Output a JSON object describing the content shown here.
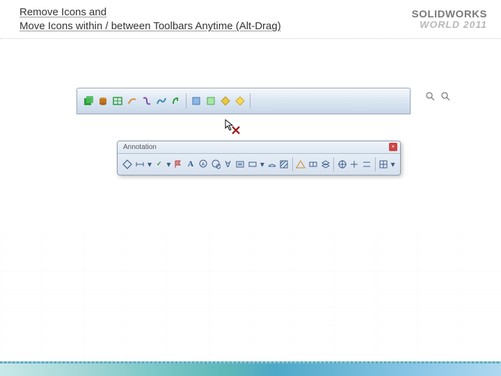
{
  "title_line1": "Remove Icons and",
  "title_line2": "Move Icons within / between Toolbars Anytime (Alt-Drag)",
  "logo": {
    "main": "SOLIDWORKS",
    "sub": "WORLD 2011"
  },
  "floating_toolbar": {
    "title": "Annotation"
  },
  "icons": {
    "main": [
      "box-green",
      "cylinder",
      "table",
      "curve-sweep",
      "curve-s",
      "spline",
      "curve-hook",
      "sep",
      "edit-a",
      "edit-b",
      "diamond",
      "diamond-yellow",
      "sep"
    ],
    "annotation": [
      "diamond-tool",
      "dim",
      "dropdown",
      "abc-check",
      "dropdown",
      "flag",
      "bold-a",
      "balloon-a",
      "balloon-b",
      "symbol-v",
      "note",
      "rect-note",
      "dropdown",
      "surface",
      "hatch",
      "sep",
      "warn",
      "tolerance",
      "layer",
      "sep",
      "target",
      "center-a",
      "center-b",
      "sep",
      "grid",
      "dropdown"
    ],
    "zoom": [
      "zoom-in",
      "zoom-out"
    ]
  },
  "colors": {
    "green": "#2a9d3a",
    "orange": "#d98a2a",
    "purple": "#7a4aa8",
    "teal": "#3a8aa8",
    "red": "#a02020"
  }
}
